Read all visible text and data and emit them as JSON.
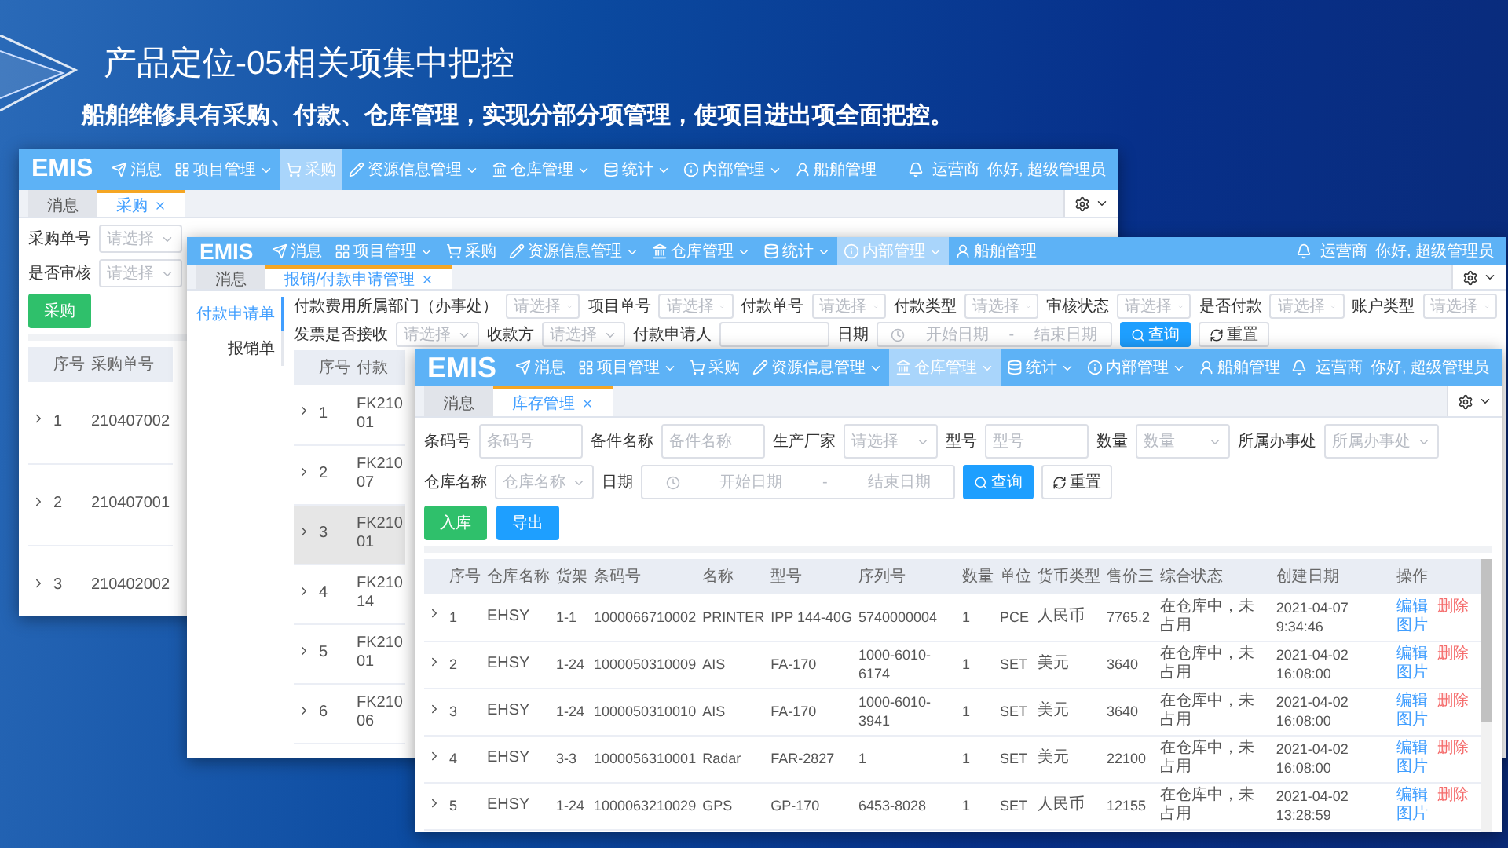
{
  "slide": {
    "title": "产品定位-05相关项集中把控",
    "subtitle": "船舶维修具有采购、付款、仓库管理，实现分部分项管理，使项目进出项全面把控。"
  },
  "windows": [
    {
      "logo": "EMIS",
      "nav": [
        {
          "label": "消息",
          "dropdown": false,
          "selected": false
        },
        {
          "label": "项目管理",
          "dropdown": true,
          "selected": false
        },
        {
          "label": "采购",
          "dropdown": false,
          "selected": true
        },
        {
          "label": "资源信息管理",
          "dropdown": true,
          "selected": false
        },
        {
          "label": "仓库管理",
          "dropdown": true,
          "selected": false
        },
        {
          "label": "统计",
          "dropdown": true,
          "selected": false
        },
        {
          "label": "内部管理",
          "dropdown": true,
          "selected": false
        },
        {
          "label": "船舶管理",
          "dropdown": false,
          "selected": false
        }
      ],
      "notice": "运营商",
      "greeting": "你好, 超级管理员",
      "tabs": [
        {
          "label": "消息",
          "closable": false,
          "selected": false
        },
        {
          "label": "采购",
          "closable": true,
          "selected": true
        }
      ],
      "filter_rows": [
        [
          {
            "kind": "select",
            "label": "采购单号",
            "placeholder": "请选择"
          }
        ],
        [
          {
            "kind": "select",
            "label": "是否审核",
            "placeholder": "请选择"
          }
        ]
      ],
      "actions": [
        {
          "label": "采购",
          "kind": "success"
        }
      ],
      "table": {
        "columns": [
          "序号",
          "采购单号"
        ],
        "rows": [
          {
            "cells": [
              "1",
              "210407002"
            ],
            "hovered": false
          },
          {
            "cells": [
              "2",
              "210407001"
            ],
            "hovered": false
          },
          {
            "cells": [
              "3",
              "210402002"
            ],
            "hovered": false
          }
        ]
      }
    },
    {
      "logo": "EMIS",
      "nav": [
        {
          "label": "消息",
          "dropdown": false,
          "selected": false
        },
        {
          "label": "项目管理",
          "dropdown": true,
          "selected": false
        },
        {
          "label": "采购",
          "dropdown": false,
          "selected": false
        },
        {
          "label": "资源信息管理",
          "dropdown": true,
          "selected": false
        },
        {
          "label": "仓库管理",
          "dropdown": true,
          "selected": false
        },
        {
          "label": "统计",
          "dropdown": true,
          "selected": false
        },
        {
          "label": "内部管理",
          "dropdown": true,
          "selected": true
        },
        {
          "label": "船舶管理",
          "dropdown": false,
          "selected": false
        }
      ],
      "notice": "运营商",
      "greeting": "你好, 超级管理员",
      "tabs": [
        {
          "label": "消息",
          "closable": false,
          "selected": false
        },
        {
          "label": "报销/付款申请管理",
          "closable": true,
          "selected": true
        }
      ],
      "side_menu": [
        {
          "label": "付款申请单",
          "selected": true
        },
        {
          "label": "报销单",
          "selected": false
        }
      ],
      "filter_rows": [
        [
          {
            "kind": "select",
            "label": "付款费用所属部门（办事处）",
            "placeholder": "请选择"
          },
          {
            "kind": "select",
            "label": "项目单号",
            "placeholder": "请选择"
          },
          {
            "kind": "select",
            "label": "付款单号",
            "placeholder": "请选择"
          },
          {
            "kind": "select",
            "label": "付款类型",
            "placeholder": "请选择"
          },
          {
            "kind": "select",
            "label": "审核状态",
            "placeholder": "请选择"
          },
          {
            "kind": "select",
            "label": "是否付款",
            "placeholder": "请选择"
          },
          {
            "kind": "select",
            "label": "账户类型",
            "placeholder": "请选择"
          }
        ],
        [
          {
            "kind": "select",
            "label": "发票是否接收",
            "placeholder": "请选择"
          },
          {
            "kind": "select",
            "label": "收款方",
            "placeholder": "请选择"
          },
          {
            "kind": "input",
            "label": "付款申请人"
          },
          {
            "kind": "daterange",
            "label": "日期",
            "start": "开始日期",
            "separator": "-",
            "end": "结束日期"
          },
          {
            "kind": "search",
            "label": "查询"
          },
          {
            "kind": "reset",
            "label": "重置"
          }
        ]
      ],
      "table": {
        "columns": [
          "序号",
          "付款"
        ],
        "rows": [
          {
            "cells": [
              "1",
              [
                "FK210",
                "01"
              ]
            ],
            "hovered": false
          },
          {
            "cells": [
              "2",
              [
                "FK210",
                "07"
              ]
            ],
            "hovered": false
          },
          {
            "cells": [
              "3",
              [
                "FK210",
                "01"
              ]
            ],
            "hovered": true
          },
          {
            "cells": [
              "4",
              [
                "FK210",
                "14"
              ]
            ],
            "hovered": false
          },
          {
            "cells": [
              "5",
              [
                "FK210",
                "01"
              ]
            ],
            "hovered": false
          },
          {
            "cells": [
              "6",
              [
                "FK210",
                "06"
              ]
            ],
            "hovered": false
          }
        ]
      }
    },
    {
      "logo": "EMIS",
      "nav": [
        {
          "label": "消息",
          "dropdown": false,
          "selected": false
        },
        {
          "label": "项目管理",
          "dropdown": true,
          "selected": false
        },
        {
          "label": "采购",
          "dropdown": false,
          "selected": false
        },
        {
          "label": "资源信息管理",
          "dropdown": true,
          "selected": false
        },
        {
          "label": "仓库管理",
          "dropdown": true,
          "selected": true
        },
        {
          "label": "统计",
          "dropdown": true,
          "selected": false
        },
        {
          "label": "内部管理",
          "dropdown": true,
          "selected": false
        },
        {
          "label": "船舶管理",
          "dropdown": false,
          "selected": false
        }
      ],
      "notice": "运营商",
      "greeting": "你好, 超级管理员",
      "tabs": [
        {
          "label": "消息",
          "closable": false,
          "selected": false
        },
        {
          "label": "库存管理",
          "closable": true,
          "selected": true
        }
      ],
      "filter_rows": [
        [
          {
            "kind": "input",
            "label": "条码号",
            "placeholder": "条码号"
          },
          {
            "kind": "input",
            "label": "备件名称",
            "placeholder": "备件名称"
          },
          {
            "kind": "select",
            "label": "生产厂家",
            "placeholder": "请选择"
          },
          {
            "kind": "input",
            "label": "型号",
            "placeholder": "型号"
          },
          {
            "kind": "select",
            "label": "数量",
            "placeholder": "数量"
          },
          {
            "kind": "select",
            "label": "所属办事处",
            "placeholder": "所属办事处"
          }
        ],
        [
          {
            "kind": "select",
            "label": "仓库名称",
            "placeholder": "仓库名称"
          },
          {
            "kind": "daterange",
            "label": "日期",
            "start": "开始日期",
            "separator": "-",
            "end": "结束日期"
          },
          {
            "kind": "search",
            "label": "查询"
          },
          {
            "kind": "reset",
            "label": "重置"
          }
        ]
      ],
      "actions": [
        {
          "label": "入库",
          "kind": "success"
        },
        {
          "label": "导出",
          "kind": "primary"
        }
      ],
      "table": {
        "scrollable": true,
        "columns": [
          "序号",
          "仓库名称",
          "货架",
          "条码号",
          "名称",
          "型号",
          "序列号",
          "数量",
          "单位",
          "货币类型",
          "售价三",
          "综合状态",
          "创建日期",
          "操作"
        ],
        "rows": [
          {
            "cells": [
              "1",
              "EHSY",
              "1-1",
              "1000066710002",
              "PRINTER",
              "IPP 144-40G",
              "5740000004",
              "1",
              "PCE",
              "人民币",
              "7765.2",
              "在仓库中，未占用",
              "2021-04-07 9:34:46"
            ],
            "hovered": false,
            "links": [
              {
                "label": "编辑",
                "kind": "edit"
              },
              {
                "label": "删除",
                "kind": "delete"
              },
              {
                "label": "图片",
                "kind": "image"
              }
            ]
          },
          {
            "cells": [
              "2",
              "EHSY",
              "1-24",
              "1000050310009",
              "AIS",
              "FA-170",
              "1000-6010-6174",
              "1",
              "SET",
              "美元",
              "3640",
              "在仓库中，未占用",
              "2021-04-02 16:08:00"
            ],
            "hovered": false,
            "links": [
              {
                "label": "编辑",
                "kind": "edit"
              },
              {
                "label": "删除",
                "kind": "delete"
              },
              {
                "label": "图片",
                "kind": "image"
              }
            ]
          },
          {
            "cells": [
              "3",
              "EHSY",
              "1-24",
              "1000050310010",
              "AIS",
              "FA-170",
              "1000-6010-3941",
              "1",
              "SET",
              "美元",
              "3640",
              "在仓库中，未占用",
              "2021-04-02 16:08:00"
            ],
            "hovered": false,
            "links": [
              {
                "label": "编辑",
                "kind": "edit"
              },
              {
                "label": "删除",
                "kind": "delete"
              },
              {
                "label": "图片",
                "kind": "image"
              }
            ]
          },
          {
            "cells": [
              "4",
              "EHSY",
              "3-3",
              "1000056310001",
              "Radar",
              "FAR-2827",
              "1",
              "1",
              "SET",
              "美元",
              "22100",
              "在仓库中，未占用",
              "2021-04-02 16:08:00"
            ],
            "hovered": false,
            "links": [
              {
                "label": "编辑",
                "kind": "edit"
              },
              {
                "label": "删除",
                "kind": "delete"
              },
              {
                "label": "图片",
                "kind": "image"
              }
            ]
          },
          {
            "cells": [
              "5",
              "EHSY",
              "1-24",
              "1000063210029",
              "GPS",
              "GP-170",
              "6453-8028",
              "1",
              "SET",
              "人民币",
              "12155",
              "在仓库中，未占用",
              "2021-04-02 13:28:59"
            ],
            "hovered": false,
            "links": [
              {
                "label": "编辑",
                "kind": "edit"
              },
              {
                "label": "删除",
                "kind": "delete"
              },
              {
                "label": "图片",
                "kind": "image"
              }
            ]
          }
        ]
      }
    }
  ]
}
